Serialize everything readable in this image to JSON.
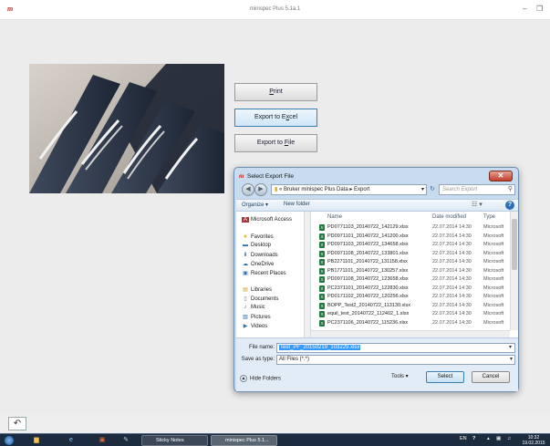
{
  "window": {
    "logo": "m",
    "title": "minispec Plus 5.1a.1",
    "minimize": "–",
    "restore": "❐"
  },
  "actions": {
    "print": "Print",
    "print_key": "P",
    "export_excel_pre": "Export to E",
    "export_excel_key": "x",
    "export_excel_post": "cel",
    "export_file_pre": "Export to ",
    "export_file_key": "F",
    "export_file_post": "ile"
  },
  "dialog": {
    "title": "Select Export File",
    "address_prefix": "«",
    "address_path": "Bruker minispec Plus Data ▸ Export",
    "search_placeholder": "Search Export",
    "toolbar": {
      "organize": "Organize ▾",
      "new_folder": "New folder"
    },
    "nav": [
      {
        "label": "Microsoft Access",
        "icon": "access-icon"
      },
      {
        "label": "Favorites",
        "icon": "star-icon"
      },
      {
        "label": "Desktop",
        "icon": "desktop-icon"
      },
      {
        "label": "Downloads",
        "icon": "downloads-icon"
      },
      {
        "label": "OneDrive",
        "icon": "cloud-icon"
      },
      {
        "label": "Recent Places",
        "icon": "recent-icon"
      },
      {
        "label": "Libraries",
        "icon": "library-icon"
      },
      {
        "label": "Documents",
        "icon": "documents-icon"
      },
      {
        "label": "Music",
        "icon": "music-icon"
      },
      {
        "label": "Pictures",
        "icon": "pictures-icon"
      },
      {
        "label": "Videos",
        "icon": "videos-icon"
      }
    ],
    "columns": {
      "name": "Name",
      "date": "Date modified",
      "type": "Type"
    },
    "files": [
      {
        "name": "PD0771103_20140722_142129.xlsx",
        "date": "22.07.2014 14:30",
        "type": "Microsoft"
      },
      {
        "name": "PD0971101_20140722_141200.xlsx",
        "date": "22.07.2014 14:30",
        "type": "Microsoft"
      },
      {
        "name": "PD0971103_20140722_134658.xlsx",
        "date": "22.07.2014 14:30",
        "type": "Microsoft"
      },
      {
        "name": "PD0971108_20140722_133801.xlsx",
        "date": "22.07.2014 14:30",
        "type": "Microsoft"
      },
      {
        "name": "PB2271101_20140722_131158.xlsx",
        "date": "22.07.2014 14:30",
        "type": "Microsoft"
      },
      {
        "name": "PB1771101_20140722_130257.xlsx",
        "date": "22.07.2014 14:30",
        "type": "Microsoft"
      },
      {
        "name": "PD0971108_20140722_123658.xlsx",
        "date": "22.07.2014 14:30",
        "type": "Microsoft"
      },
      {
        "name": "PC2371101_20140722_122830.xlsx",
        "date": "22.07.2014 14:30",
        "type": "Microsoft"
      },
      {
        "name": "PD0171102_20140722_120256.xlsx",
        "date": "22.07.2014 14:30",
        "type": "Microsoft"
      },
      {
        "name": "BOPP_Test2_20140722_113130.xlsx",
        "date": "22.07.2014 14:30",
        "type": "Microsoft"
      },
      {
        "name": "equil_test_20140722_112402_1.xlsx",
        "date": "22.07.2014 14:30",
        "type": "Microsoft"
      },
      {
        "name": "PC2371106_20140722_115236.xlsx",
        "date": "22.07.2014 14:30",
        "type": "Microsoft"
      }
    ],
    "file_name_label": "File name:",
    "file_name_value": "Test_PF_20150219_103229.xlsx",
    "save_type_label": "Save as type:",
    "save_type_value": "All Files (*.*)",
    "hide_folders": "Hide Folders",
    "tools": "Tools",
    "select": "Select",
    "cancel": "Cancel"
  },
  "taskbar": {
    "sticky_notes": "Sticky Notes",
    "minispec": "minispec Plus 5.1...",
    "lang": "EN",
    "time": "10:32",
    "date": "19.02.2015"
  },
  "colors": {
    "accent": "#3399ff",
    "brand": "#c62828",
    "taskbar": "#1c2b3d"
  }
}
